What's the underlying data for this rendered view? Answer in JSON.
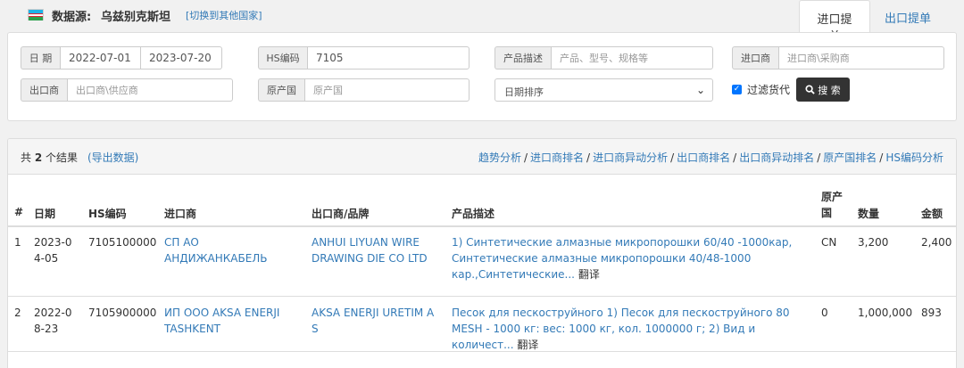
{
  "header": {
    "source_label": "数据源:",
    "source_country": "乌兹别克斯坦",
    "switch_link": "[切换到其他国家]",
    "tabs": [
      {
        "label": "进口提单",
        "active": true
      },
      {
        "label": "出口提单",
        "active": false
      }
    ]
  },
  "filters": {
    "date": {
      "label": "日 期",
      "from": "2022-07-01",
      "to": "2023-07-20"
    },
    "hs": {
      "label": "HS编码",
      "value": "7105"
    },
    "product": {
      "label": "产品描述",
      "placeholder": "产品、型号、规格等"
    },
    "importer": {
      "label": "进口商",
      "placeholder": "进口商\\采购商"
    },
    "exporter": {
      "label": "出口商",
      "placeholder": "出口商\\供应商"
    },
    "origin": {
      "label": "原产国",
      "placeholder": "原产国"
    },
    "sort": {
      "selected": "日期排序"
    },
    "filter_goods": {
      "label": "过滤货代",
      "checked": true
    },
    "search_button": "搜 索"
  },
  "results": {
    "count_prefix": "共",
    "count": "2",
    "count_suffix": "个结果",
    "export_link": "(导出数据)",
    "analysis_links": [
      "趋势分析",
      "进口商排名",
      "进口商异动分析",
      "出口商排名",
      "出口商异动排名",
      "原产国排名",
      "HS编码分析"
    ],
    "columns": [
      "#",
      "日期",
      "HS编码",
      "进口商",
      "出口商/品牌",
      "产品描述",
      "原产国",
      "数量",
      "金额"
    ],
    "rows": [
      {
        "num": "1",
        "date": "2023-04-05",
        "hs": "7105100000",
        "importer": "СП АО АНДИЖАНКАБЕЛЬ",
        "exporter": "ANHUI LIYUAN WIRE DRAWING DIE CO LTD",
        "description": "1) Синтетические алмазные микропорошки 60/40 -1000кар, Синтетические алмазные микропорошки 40/48-1000 кар.,Синтетические...",
        "translate": "翻译",
        "origin": "CN",
        "quantity": "3,200",
        "amount": "2,400"
      },
      {
        "num": "2",
        "date": "2022-08-23",
        "hs": "7105900000",
        "importer": "ИП ООО AKSA ENERJI TASHKENT",
        "exporter": "AKSA ENERJI URETIM A S",
        "description": "Песок для пескоструйного 1) Песок для пескоструйного 80 MESH - 1000 кг: вес: 1000 кг, кол. 1000000 г; 2) Вид и количест...",
        "translate": "翻译",
        "origin": "0",
        "quantity": "1,000,000",
        "amount": "893"
      }
    ]
  }
}
